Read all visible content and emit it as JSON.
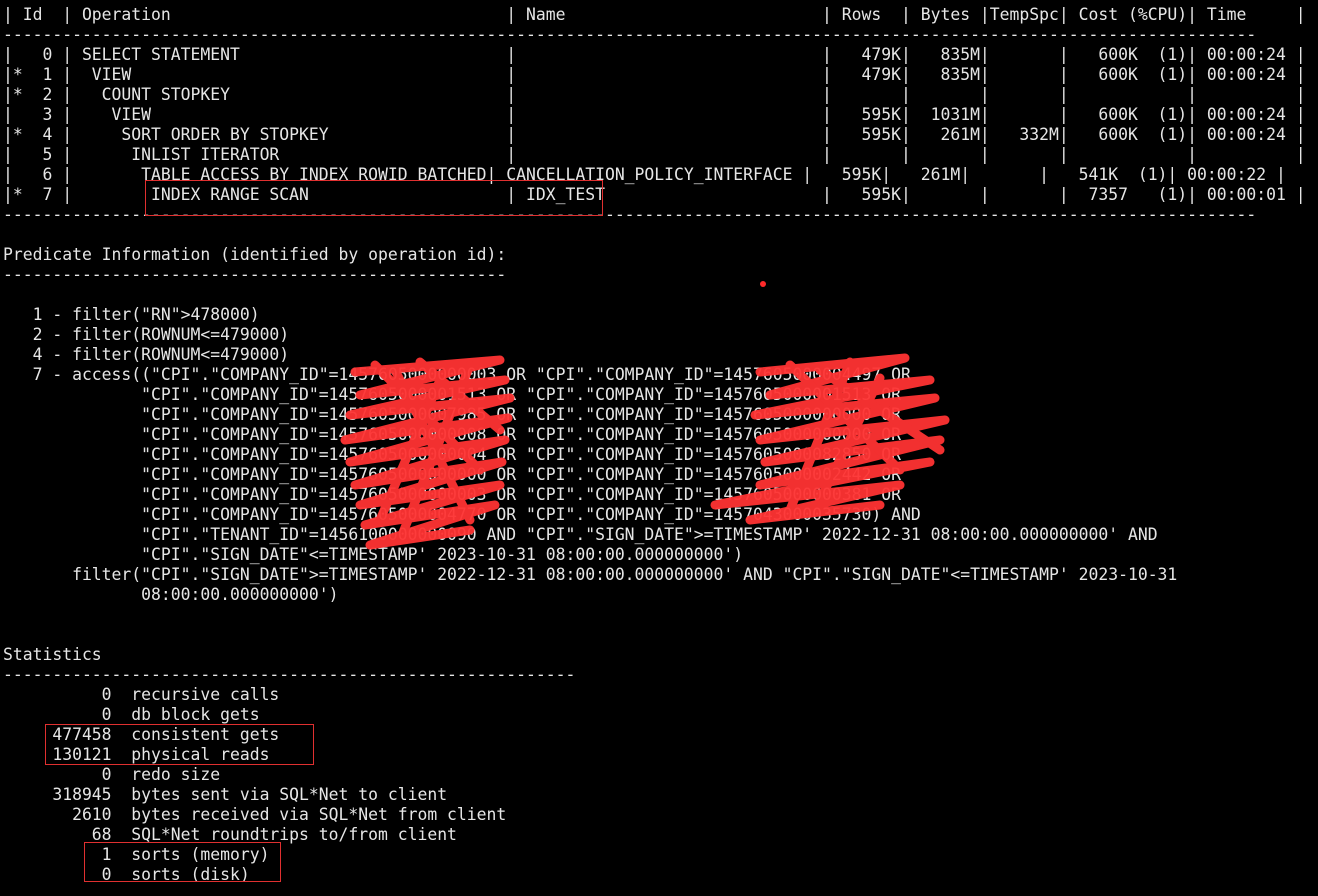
{
  "terminal": {
    "lines": [
      "| Id  | Operation                                  | Name                          | Rows  | Bytes |TempSpc| Cost (%CPU)| Time     |",
      "-------------------------------------------------------------------------------------------------------------------------------",
      "|   0 | SELECT STATEMENT                           |                               |   479K|   835M|       |   600K  (1)| 00:00:24 |",
      "|*  1 |  VIEW                                      |                               |   479K|   835M|       |   600K  (1)| 00:00:24 |",
      "|*  2 |   COUNT STOPKEY                            |                               |       |       |       |            |          |",
      "|   3 |    VIEW                                    |                               |   595K|  1031M|       |   600K  (1)| 00:00:24 |",
      "|*  4 |     SORT ORDER BY STOPKEY                  |                               |   595K|   261M|   332M|   600K  (1)| 00:00:24 |",
      "|   5 |      INLIST ITERATOR                       |                               |       |       |       |            |          |",
      "|   6 |       TABLE ACCESS BY INDEX ROWID BATCHED| CANCELLATION_POLICY_INTERFACE |   595K|   261M|       |   541K  (1)| 00:00:22 |",
      "|*  7 |        INDEX RANGE SCAN                    | IDX_TEST                      |   595K|       |       |  7357   (1)| 00:00:01 |",
      "-------------------------------------------------------------------------------------------------------------------------------",
      "",
      "Predicate Information (identified by operation id):",
      "---------------------------------------------------",
      "",
      "   1 - filter(\"RN\">478000)",
      "   2 - filter(ROWNUM<=479000)",
      "   4 - filter(ROWNUM<=479000)",
      "   7 - access((\"CPI\".\"COMPANY_ID\"=1457605000000003 OR \"CPI\".\"COMPANY_ID\"=1457605000004497 OR",
      "              \"CPI\".\"COMPANY_ID\"=1457605000001513 OR \"CPI\".\"COMPANY_ID\"=1457605000001513 OR",
      "              \"CPI\".\"COMPANY_ID\"=1457605000007985 OR \"CPI\".\"COMPANY_ID\"=1457605000000000 OR",
      "              \"CPI\".\"COMPANY_ID\"=1457605000000008 OR \"CPI\".\"COMPANY_ID\"=1457605000000000 OR",
      "              \"CPI\".\"COMPANY_ID\"=1457605000000004 OR \"CPI\".\"COMPANY_ID\"=1457605000082850 OR",
      "              \"CPI\".\"COMPANY_ID\"=1457605000000000 OR \"CPI\".\"COMPANY_ID\"=1457605000002442 OR",
      "              \"CPI\".\"COMPANY_ID\"=1457605000000003 OR \"CPI\".\"COMPANY_ID\"=1457605000000381 OR",
      "              \"CPI\".\"COMPANY_ID\"=1457605000004770 OR \"CPI\".\"COMPANY_ID\"=1457043000035730) AND",
      "              \"CPI\".\"TENANT_ID\"=1456100000000090 AND \"CPI\".\"SIGN_DATE\">=TIMESTAMP' 2022-12-31 08:00:00.000000000' AND",
      "              \"CPI\".\"SIGN_DATE\"<=TIMESTAMP' 2023-10-31 08:00:00.000000000')",
      "       filter(\"CPI\".\"SIGN_DATE\">=TIMESTAMP' 2022-12-31 08:00:00.000000000' AND \"CPI\".\"SIGN_DATE\"<=TIMESTAMP' 2023-10-31",
      "              08:00:00.000000000')",
      "",
      "",
      "Statistics",
      "----------------------------------------------------------",
      "          0  recursive calls",
      "          0  db block gets",
      "     477458  consistent gets",
      "     130121  physical reads",
      "          0  redo size",
      "     318945  bytes sent via SQL*Net to client",
      "       2610  bytes received via SQL*Net from client",
      "         68  SQL*Net roundtrips to/from client",
      "          1  sorts (memory)",
      "          0  sorts (disk)"
    ]
  },
  "colors": {
    "background": "#000000",
    "text": "#e6e6e6",
    "highlight_box": "#e03030",
    "redaction": "#ff3333"
  }
}
